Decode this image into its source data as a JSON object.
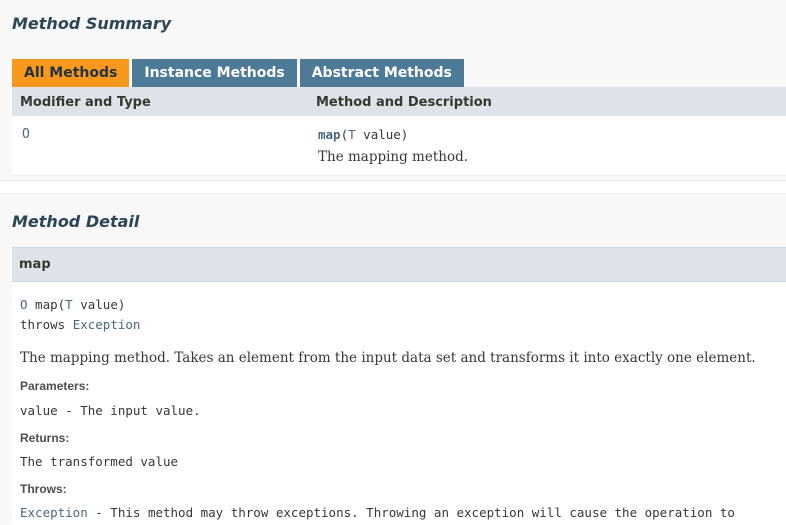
{
  "summary": {
    "title": "Method Summary",
    "tabs": [
      {
        "label": "All Methods"
      },
      {
        "label": "Instance Methods"
      },
      {
        "label": "Abstract Methods"
      }
    ],
    "columns": [
      "Modifier and Type",
      "Method and Description"
    ],
    "row": {
      "type": "O",
      "method_name": "map",
      "open_paren": "(",
      "param_type": "T",
      "param_rest": " value)",
      "description": "The mapping method."
    }
  },
  "detail": {
    "title": "Method Detail",
    "method_header": "map",
    "sig_return": "O",
    "sig_name": " map(",
    "sig_param_type": "T",
    "sig_param_rest": " value)",
    "throws_kw": "throws ",
    "throws_type": "Exception",
    "description": "The mapping method. Takes an element from the input data set and transforms it into exactly one element.",
    "parameters_label": "Parameters:",
    "parameter_text": "value - The input value.",
    "returns_label": "Returns:",
    "returns_text": "The transformed value",
    "throws_label": "Throws:",
    "throws_link": "Exception",
    "throws_text": " - This method may throw exceptions. Throwing an exception will cause the operation to"
  },
  "colors": {
    "active_tab": "#f8981d",
    "inactive_tab": "#4d7a97",
    "header_bg": "#dee3e9",
    "link": "#4a6782",
    "title": "#2c4557"
  }
}
